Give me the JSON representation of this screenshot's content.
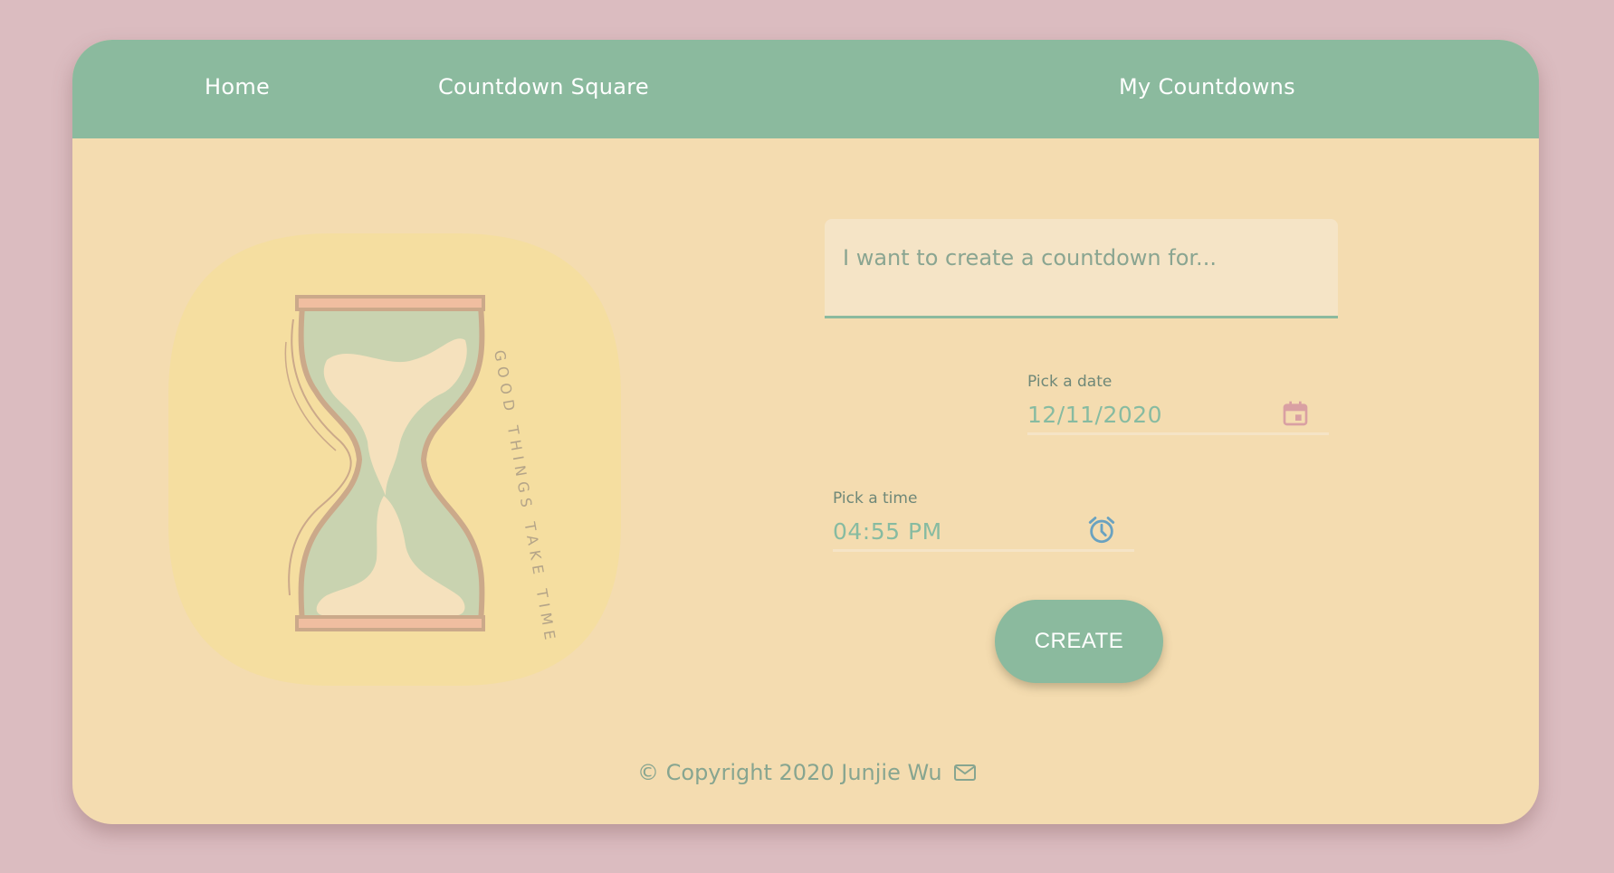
{
  "nav": {
    "home": "Home",
    "square": "Countdown Square",
    "mine": "My Countdowns"
  },
  "illustration": {
    "caption": "GOOD THINGS TAKE TIME",
    "icon": "hourglass-icon"
  },
  "form": {
    "description_placeholder": "I want to create a countdown for...",
    "date_label": "Pick a date",
    "date_value": "12/11/2020",
    "date_icon": "calendar-icon",
    "time_label": "Pick a time",
    "time_value": "04:55 PM",
    "time_icon": "alarm-clock-icon",
    "create_label": "CREATE"
  },
  "footer": {
    "copyright": "© Copyright 2020 Junjie Wu",
    "icon": "mail-icon"
  },
  "colors": {
    "background": "#dbbcc0",
    "card": "#f4dcb0",
    "accent": "#8bba9e",
    "calendar_icon": "#d9a0a3",
    "clock_icon": "#6aa2c0"
  }
}
